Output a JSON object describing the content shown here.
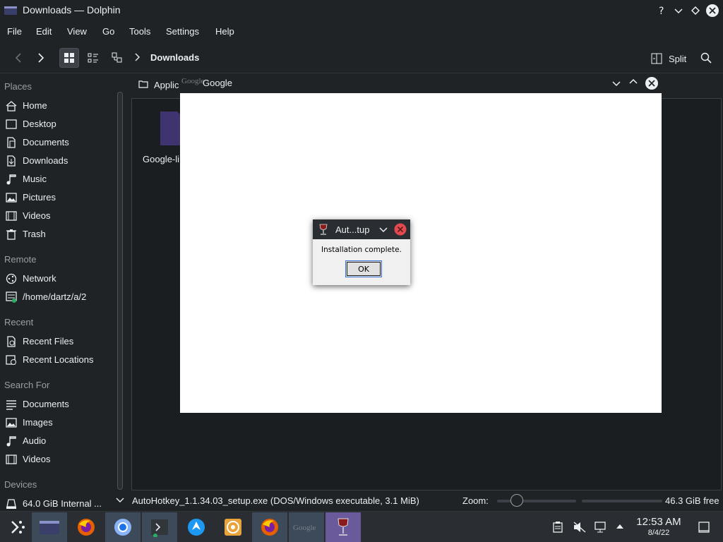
{
  "window": {
    "title": "Downloads — Dolphin"
  },
  "menu": [
    "File",
    "Edit",
    "View",
    "Go",
    "Tools",
    "Settings",
    "Help"
  ],
  "toolbar": {
    "location": "Downloads",
    "split_label": "Split"
  },
  "sidebar": {
    "places_header": "Places",
    "places": [
      {
        "label": "Home",
        "icon": "home-icon"
      },
      {
        "label": "Desktop",
        "icon": "desktop-icon"
      },
      {
        "label": "Documents",
        "icon": "documents-icon"
      },
      {
        "label": "Downloads",
        "icon": "downloads-icon"
      },
      {
        "label": "Music",
        "icon": "music-icon"
      },
      {
        "label": "Pictures",
        "icon": "pictures-icon"
      },
      {
        "label": "Videos",
        "icon": "videos-icon"
      },
      {
        "label": "Trash",
        "icon": "trash-icon"
      }
    ],
    "remote_header": "Remote",
    "remote": [
      {
        "label": "Network",
        "icon": "network-icon"
      },
      {
        "label": "/home/dartz/a/2",
        "icon": "network-share-icon"
      }
    ],
    "recent_header": "Recent",
    "recent": [
      {
        "label": "Recent Files",
        "icon": "recent-files-icon"
      },
      {
        "label": "Recent Locations",
        "icon": "recent-locations-icon"
      }
    ],
    "search_header": "Search For",
    "search": [
      {
        "label": "Documents",
        "icon": "documents-search-icon"
      },
      {
        "label": "Images",
        "icon": "images-icon"
      },
      {
        "label": "Audio",
        "icon": "audio-icon"
      },
      {
        "label": "Videos",
        "icon": "videos-search-icon"
      }
    ],
    "devices_header": "Devices",
    "devices": [
      {
        "label": "64.0 GiB Internal ...",
        "icon": "drive-icon"
      }
    ]
  },
  "main": {
    "crumb_partial": "Applic",
    "file_label_partial": "Google-li"
  },
  "google_window": {
    "title": "Google",
    "icon_text": "Google"
  },
  "dialog": {
    "title": "Aut...tup",
    "message": "Installation complete.",
    "ok_label": "OK"
  },
  "status": {
    "file_info": "AutoHotkey_1.1.34.03_setup.exe (DOS/Windows executable, 3.1 MiB)",
    "zoom_label": "Zoom:",
    "zoom_level": 0.2,
    "free_space": "46.3 GiB free"
  },
  "taskbar": {
    "tasks": [
      "application-launcher",
      "dolphin",
      "firefox",
      "chromium",
      "konsole",
      "discover",
      "brave",
      "firefox",
      "google",
      "wine"
    ],
    "clock_time": "12:53 AM",
    "clock_date": "8/4/22"
  },
  "colors": {
    "accent": "#3daee9",
    "window_bg": "#202326",
    "view_bg": "#1b1e20",
    "close_red": "#e24a4f"
  }
}
